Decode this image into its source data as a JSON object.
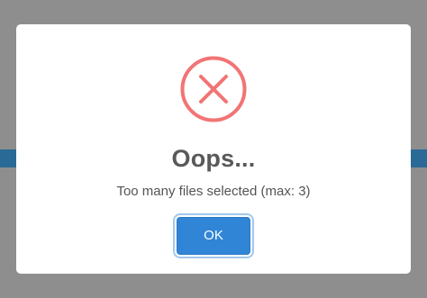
{
  "dialog": {
    "title": "Oops...",
    "message": "Too many files selected (max: 3)",
    "ok_label": "OK",
    "icon": "error-x-icon"
  },
  "colors": {
    "error_icon": "#f27474",
    "button": "#3085d6",
    "title_text": "#595959",
    "message_text": "#545454",
    "overlay": "#8e8e8e",
    "background_band": "#2a6a96"
  }
}
